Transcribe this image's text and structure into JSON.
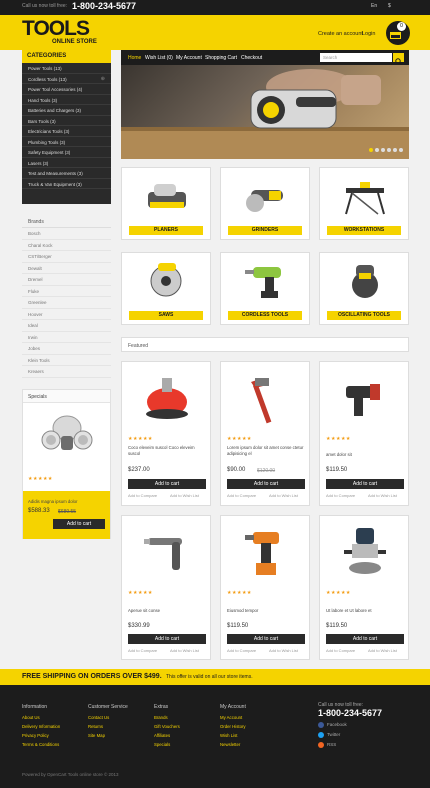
{
  "topbar": {
    "call_label": "Call us now toll free:",
    "phone": "1-800-234-5677",
    "lang": "En",
    "currency": "$"
  },
  "header": {
    "logo": "TOOLS",
    "logo_sub": "ONLINE STORE",
    "create_account": "Create an account",
    "login": "Login",
    "cart_count": "0"
  },
  "categories": {
    "title": "CATEGORIES",
    "items": [
      "Power Tools (13)",
      "Cordless Tools (13)",
      "Power Tool Accessories (4)",
      "Hand Tools (3)",
      "Batteries and Chargers (3)",
      "Bars Tools (3)",
      "Electricians Tools (3)",
      "Plumbing Tools (3)",
      "Safety Equipment (3)",
      "Lasers (3)",
      "Test and Measurements (3)",
      "Truck & Van Equipment (3)"
    ]
  },
  "brands": {
    "title": "Brands",
    "items": [
      "Bosch",
      "Charal Kock",
      "CST/Berger",
      "Dewalt",
      "Dremel",
      "Fluke",
      "Greenlee",
      "Hoover",
      "Ideal",
      "Irwin",
      "Jobes",
      "Klein Tools",
      "Kreaers"
    ]
  },
  "specials": {
    "title": "Specials",
    "name": "Adidis magna ipsum dolor",
    "price": "$588.33",
    "old_price": "$689.55",
    "add": "Add to cart"
  },
  "nav": {
    "items": [
      "Home",
      "Wish List (0)",
      "My Account",
      "Shopping Cart",
      "Checkout"
    ],
    "search_placeholder": "Search"
  },
  "tiles": [
    "PLANERS",
    "GRINDERS",
    "WORKSTATIONS",
    "SAWS",
    "CORDLESS TOOLS",
    "OSCILLATING TOOLS"
  ],
  "featured": {
    "title": "Featured"
  },
  "products": [
    {
      "name": "Coco eleveim suscol Coco eleveim suscol",
      "price": "$237.00",
      "old": "",
      "add": "Add to cart",
      "compare": "Add to Compare",
      "wish": "Add to Wish List"
    },
    {
      "name": "Lorem ipsum dolor sit amet conse ctetur adipisicing el",
      "price": "$90.00",
      "old": "$120.00",
      "add": "Add to cart",
      "compare": "Add to Compare",
      "wish": "Add to Wish List"
    },
    {
      "name": "amet dolor sit",
      "price": "$119.50",
      "old": "",
      "add": "Add to cart",
      "compare": "Add to Compare",
      "wish": "Add to Wish List"
    },
    {
      "name": "Aperue sit conse",
      "price": "$330.99",
      "old": "",
      "add": "Add to cart",
      "compare": "Add to Compare",
      "wish": "Add to Wish List"
    },
    {
      "name": "Eiusmod tempor",
      "price": "$119.50",
      "old": "",
      "add": "Add to cart",
      "compare": "Add to Compare",
      "wish": "Add to Wish List"
    },
    {
      "name": "Ut labore et Ut labore et",
      "price": "$119.50",
      "old": "",
      "add": "Add to cart",
      "compare": "Add to Compare",
      "wish": "Add to Wish List"
    }
  ],
  "freeship": {
    "title": "FREE SHIPPING ON ORDERS OVER $499.",
    "text": "This offer is valid on all our store items."
  },
  "footer": {
    "info": {
      "title": "Information",
      "links": [
        "About Us",
        "Delivery Information",
        "Privacy Policy",
        "Terms & Conditions"
      ]
    },
    "service": {
      "title": "Customer Service",
      "links": [
        "Contact Us",
        "Returns",
        "Site Map"
      ]
    },
    "extras": {
      "title": "Extras",
      "links": [
        "Brands",
        "Gift Vouchers",
        "Affiliates",
        "Specials"
      ]
    },
    "account": {
      "title": "My Account",
      "links": [
        "My Account",
        "Order History",
        "Wish List",
        "Newsletter"
      ]
    },
    "call_label": "Call us now toll free:",
    "phone": "1-800-234-5677",
    "social": [
      "Facebook",
      "Twitter",
      "RSS"
    ],
    "powered": "Powered by OpenCart Tools online store © 2013"
  },
  "colors": {
    "accent": "#f5d300",
    "dark": "#1c1c1c"
  }
}
